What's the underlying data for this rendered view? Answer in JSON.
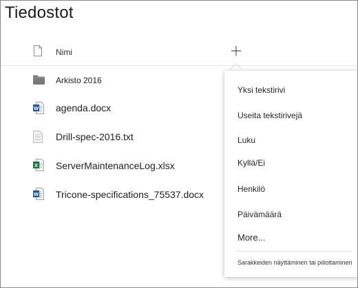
{
  "page": {
    "title": "Tiedostot"
  },
  "header": {
    "name_column": "Nimi",
    "add_column_symbol": "+"
  },
  "files": [
    {
      "name": "Arkisto 2016",
      "icon": "folder-icon",
      "kind": "folder"
    },
    {
      "name": "agenda.docx",
      "icon": "word-doc-icon",
      "kind": "file"
    },
    {
      "name": "Drill-spec-2016.txt",
      "icon": "text-file-icon",
      "kind": "file"
    },
    {
      "name": "ServerMaintenanceLog.xlsx",
      "icon": "excel-icon",
      "kind": "file"
    },
    {
      "name": "Tricone-specifications_75537.docx",
      "icon": "word-doc-icon",
      "kind": "file"
    }
  ],
  "column_menu": {
    "items": [
      {
        "label": "Yksi tekstirivi"
      },
      {
        "label": "Useita tekstirivejä"
      },
      {
        "label": "Luku"
      },
      {
        "label": "Kyllä/Ei"
      },
      {
        "label": "Henkilö"
      },
      {
        "label": "Päivämäärä"
      },
      {
        "label": "More..."
      }
    ],
    "footer": "Sarakkeiden näyttäminen tai piilottaminen"
  },
  "colors": {
    "word": "#2b579a",
    "excel": "#217346",
    "folder": "#7a7a7a",
    "text_icon": "#bdbdbd"
  }
}
